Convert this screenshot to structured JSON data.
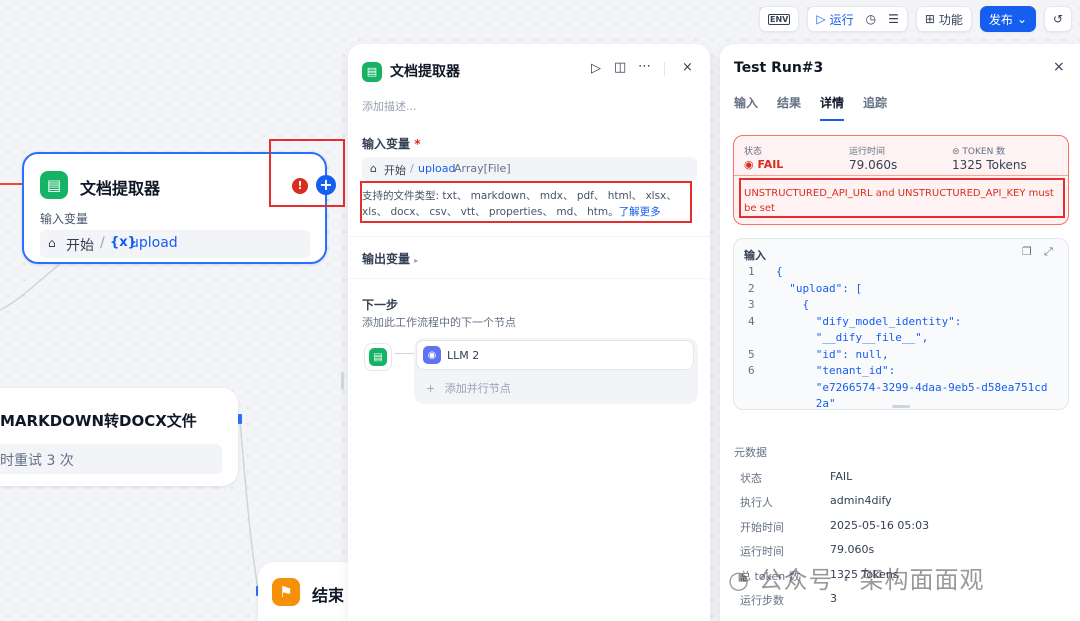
{
  "toolbar": {
    "env_label": "ENV",
    "run_label": "运行",
    "features_label": "功能",
    "publish_label": "发布"
  },
  "canvas": {
    "extractor_node": {
      "title": "文档提取器",
      "input_label": "输入变量",
      "start_label": "开始",
      "var_symbol": "{x}",
      "var_name": "upload"
    },
    "markdown_node": {
      "title": "MARKDOWN转DOCX文件",
      "retry_text": "时重试 3 次"
    },
    "end_node": {
      "title": "结束"
    }
  },
  "middle_panel": {
    "title": "文档提取器",
    "description_placeholder": "添加描述...",
    "input_section_label": "输入变量",
    "required_mark": "*",
    "var_start": "开始",
    "var_sep": "/",
    "var_name": "upload",
    "var_type": "Array[File]",
    "supported_types_text": "支持的文件类型: txt、 markdown、 mdx、 pdf、 html、 xlsx、 xls、 docx、 csv、 vtt、 properties、 md、 htm。",
    "learn_more": "了解更多",
    "output_section_label": "输出变量",
    "next_step_label": "下一步",
    "next_step_desc": "添加此工作流程中的下一个节点",
    "next_node_name": "LLM 2",
    "add_parallel": "添加并行节点"
  },
  "right_panel": {
    "title": "Test Run#3",
    "tabs": [
      "输入",
      "结果",
      "详情",
      "追踪"
    ],
    "active_tab": "详情",
    "status_header": "状态",
    "runtime_header": "运行时间",
    "tokens_header": "TOKEN 数",
    "status_value": "FAIL",
    "runtime_value": "79.060s",
    "tokens_value": "1325 Tokens",
    "error_message": "UNSTRUCTURED_API_URL and UNSTRUCTURED_API_KEY must be set",
    "input_block_label": "输入",
    "code_lines": [
      {
        "n": "1",
        "text": "{"
      },
      {
        "n": "2",
        "text": "  \"upload\": ["
      },
      {
        "n": "3",
        "text": "    {"
      },
      {
        "n": "4",
        "text": "      \"dify_model_identity\":"
      },
      {
        "n": "",
        "text": "      \"__dify__file__\","
      },
      {
        "n": "5",
        "text": "      \"id\": null,"
      },
      {
        "n": "6",
        "text": "      \"tenant_id\":"
      },
      {
        "n": "",
        "text": "      \"e7266574-3299-4daa-9eb5-d58ea751cd"
      },
      {
        "n": "",
        "text": "      2a\""
      }
    ],
    "metadata_label": "元数据",
    "metadata": [
      {
        "label": "状态",
        "value": "FAIL"
      },
      {
        "label": "执行人",
        "value": "admin4dify"
      },
      {
        "label": "开始时间",
        "value": "2025-05-16 05:03"
      },
      {
        "label": "运行时间",
        "value": "79.060s"
      },
      {
        "label": "总 token 数",
        "value": "1325 Tokens"
      },
      {
        "label": "运行步数",
        "value": "3"
      }
    ]
  },
  "watermark": "公众号 · 架构面面观",
  "colors": {
    "accent": "#155eef",
    "error": "#d92d20",
    "error_bg": "#fef3f2",
    "node_green": "#16b364",
    "end_orange": "#f79009"
  }
}
